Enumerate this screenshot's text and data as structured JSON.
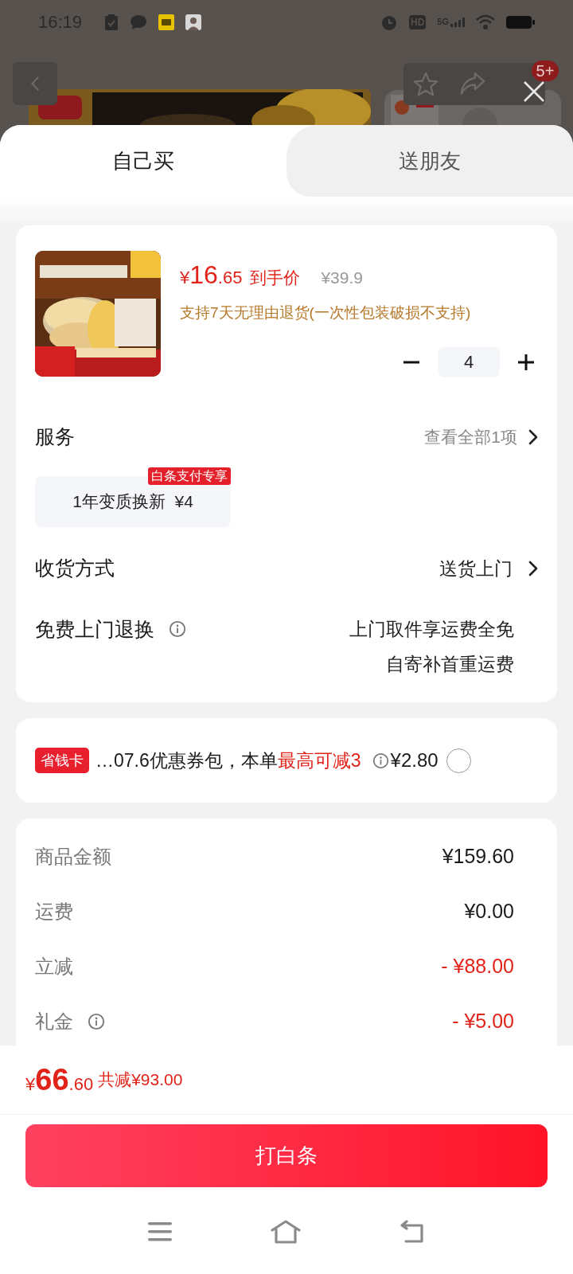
{
  "status_bar": {
    "time": "16:19",
    "hd": "HD",
    "network": "5G"
  },
  "background_page": {
    "badge": "5+"
  },
  "tabs": [
    {
      "label": "自己买",
      "selected": true
    },
    {
      "label": "送朋友",
      "selected": false
    }
  ],
  "product": {
    "price": {
      "symbol": "¥",
      "integer": "16",
      "decimal": ".65"
    },
    "price_label": "到手价",
    "original_price": "¥39.9",
    "return_policy": "支持7天无理由退货(一次性包装破损不支持)",
    "quantity": "4"
  },
  "services": {
    "title": "服务",
    "view_all": "查看全部1项",
    "options": [
      {
        "tag": "白条支付专享",
        "label": "1年变质换新  ¥4",
        "selected": false
      }
    ]
  },
  "delivery": {
    "label": "收货方式",
    "value": "送货上门"
  },
  "free_return": {
    "label": "免费上门退换",
    "lines": [
      "上门取件享运费全免",
      "自寄补首重运费"
    ]
  },
  "coupon": {
    "tag": "省钱卡",
    "text": "…07.6优惠券包，本单",
    "highlight": "最高可减3",
    "price": "¥2.80",
    "checked": false
  },
  "summary": [
    {
      "label": "商品金额",
      "value": "¥159.60",
      "kind": "amount",
      "info": false
    },
    {
      "label": "运费",
      "value": "¥0.00",
      "kind": "amount",
      "info": false
    },
    {
      "label": "立减",
      "value": "- ¥88.00",
      "kind": "deduction",
      "info": false
    },
    {
      "label": "礼金",
      "value": "- ¥5.00",
      "kind": "deduction",
      "info": true
    }
  ],
  "footer": {
    "total": {
      "symbol": "¥",
      "integer": "66",
      "decimal": ".60"
    },
    "savings": "共减¥93.00",
    "button": "打白条"
  }
}
